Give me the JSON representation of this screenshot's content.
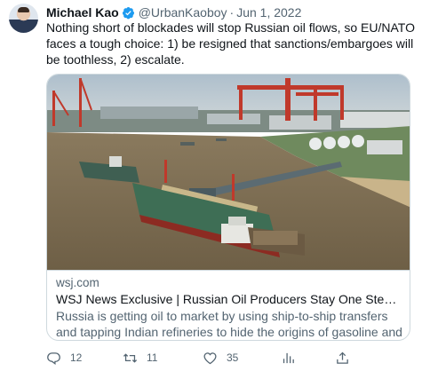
{
  "tweet": {
    "author_name": "Michael Kao",
    "handle": "@UrbanKaoboy",
    "separator": "·",
    "date": "Jun 1, 2022",
    "text": "Nothing short of blockades will stop Russian oil flows, so EU/NATO faces a tough choice: 1) be resigned that sanctions/embargoes will be toothless, 2) escalate."
  },
  "card": {
    "domain": "wsj.com",
    "title": "WSJ News Exclusive | Russian Oil Producers Stay One Step Ahead of ...",
    "description": "Russia is getting oil to market by using ship-to-ship transfers and tapping Indian refineries to hide the origins of gasoline and other fuels."
  },
  "actions": {
    "replies": "12",
    "retweets": "11",
    "likes": "35"
  },
  "colors": {
    "verified": "#1d9bf0",
    "secondary_text": "#536471",
    "border": "#cfd9de"
  },
  "icons": [
    "verified-badge-icon",
    "reply-icon",
    "retweet-icon",
    "like-icon",
    "analytics-icon",
    "share-icon"
  ]
}
